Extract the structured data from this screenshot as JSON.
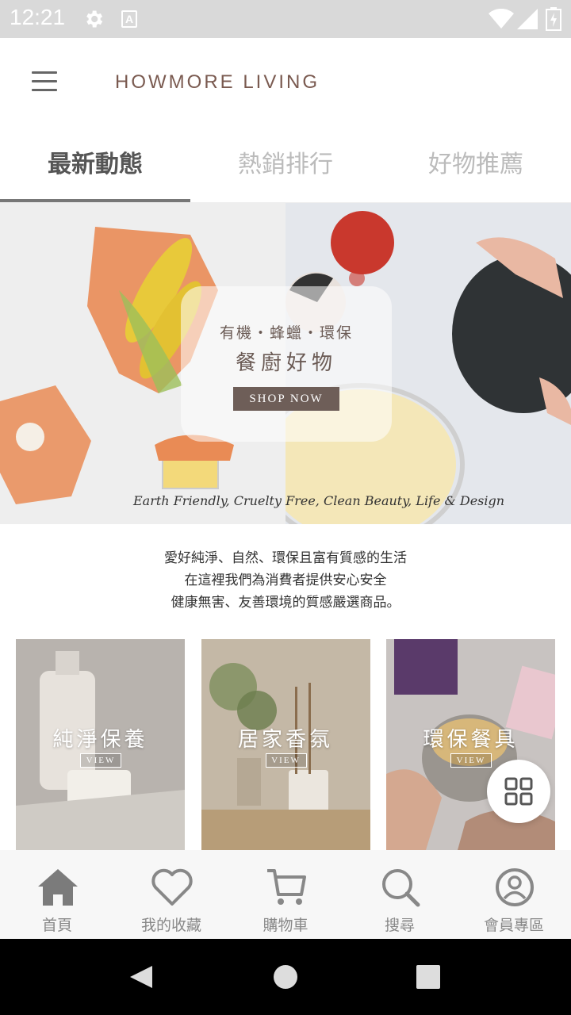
{
  "status_bar": {
    "time": "12:21",
    "icons": [
      "gear-icon",
      "text-a-icon",
      "wifi-icon",
      "signal-icon",
      "battery-icon"
    ],
    "a_icon_letter": "A"
  },
  "header": {
    "brand": "HOWMORE LIVING",
    "menu_icon": "hamburger-menu-icon"
  },
  "tabs": [
    {
      "label": "最新動態",
      "active": true
    },
    {
      "label": "熱銷排行",
      "active": false
    },
    {
      "label": "好物推薦",
      "active": false
    }
  ],
  "hero": {
    "tagline": "有機・蜂蠟・環保",
    "title": "餐廚好物",
    "cta": "SHOP NOW",
    "script": "Earth Friendly, Cruelty Free, Clean Beauty, Life & Design"
  },
  "intro": {
    "lines": [
      "愛好純淨、自然、環保且富有質感的生活",
      "在這裡我們為消費者提供安心安全",
      "健康無害、友善環境的質感嚴選商品。"
    ]
  },
  "categories": [
    {
      "title": "純淨保養",
      "view": "VIEW"
    },
    {
      "title": "居家香氛",
      "view": "VIEW"
    },
    {
      "title": "環保餐具",
      "view": "VIEW"
    }
  ],
  "fab": {
    "icon": "grid-icon"
  },
  "bottom_nav": [
    {
      "label": "首頁",
      "icon": "home-icon",
      "active": true
    },
    {
      "label": "我的收藏",
      "icon": "heart-icon",
      "active": false
    },
    {
      "label": "購物車",
      "icon": "cart-icon",
      "active": false
    },
    {
      "label": "搜尋",
      "icon": "search-icon",
      "active": false
    },
    {
      "label": "會員專區",
      "icon": "user-icon",
      "active": false
    }
  ],
  "colors": {
    "brand": "#7a5a50",
    "status_bar": "#d9d9d9",
    "cta": "#6e5e58",
    "nav_icon": "#888888",
    "nav_icon_active": "#7b7b7b"
  }
}
